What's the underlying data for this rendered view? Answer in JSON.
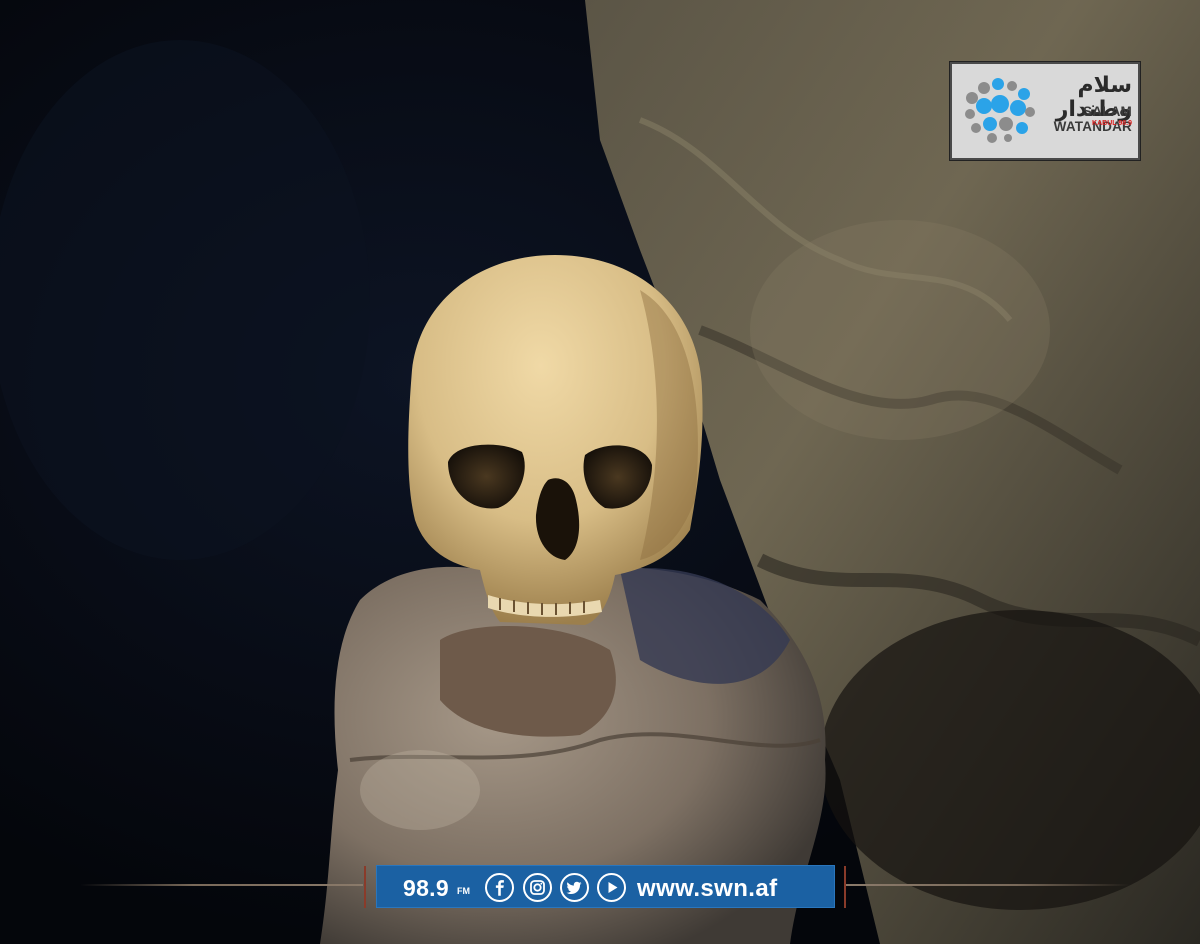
{
  "photo": {
    "subject": "human-skull-on-rock",
    "colors": {
      "background": "#05070c",
      "skull": "#d9c08a",
      "rock": "#8a7c6c",
      "wall": "#6b6350"
    }
  },
  "logo": {
    "arabic_name": "سلام وطندار",
    "english_name": "SALAM WATANDAR",
    "city_freq": "KABUL 98.9",
    "colors": {
      "dots_blue": "#2ba3e8",
      "dots_gray": "#8c8c8c",
      "box": "#d9d9d9"
    }
  },
  "footer_bar": {
    "frequency": "98.9",
    "frequency_unit": "FM",
    "website": "www.swn.af",
    "social_icons": [
      "facebook-icon",
      "instagram-icon",
      "twitter-icon",
      "youtube-icon"
    ],
    "colors": {
      "bar": "#1b61a3",
      "text": "#ffffff",
      "accent": "#8a3b2a"
    }
  }
}
